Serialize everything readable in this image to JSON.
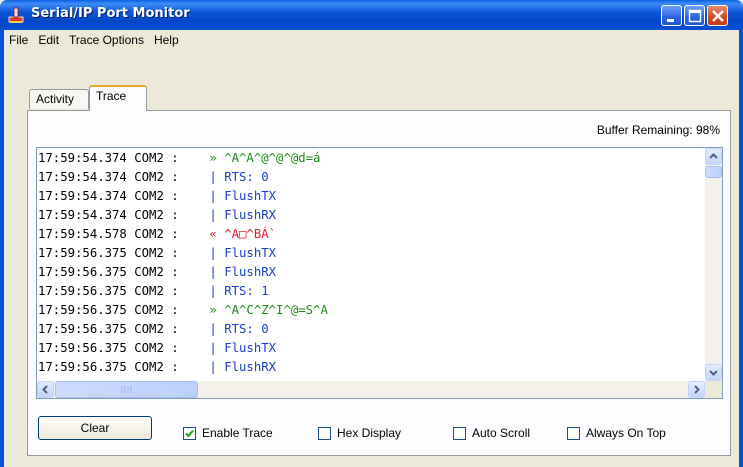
{
  "window": {
    "title": "Serial/IP Port Monitor"
  },
  "menu": [
    "File",
    "Edit",
    "Trace Options",
    "Help"
  ],
  "tabs": [
    {
      "label": "Activity",
      "active": false
    },
    {
      "label": "Trace",
      "active": true
    }
  ],
  "buffer_label": "Buffer Remaining: 98%",
  "trace_rows": [
    {
      "time": "17:59:54.374",
      "port": "COM2",
      "kind": "tx",
      "marker": "»",
      "text": "^A^A^@^@^@d=á"
    },
    {
      "time": "17:59:54.374",
      "port": "COM2",
      "kind": "ctl",
      "marker": "|",
      "text": "RTS: 0"
    },
    {
      "time": "17:59:54.374",
      "port": "COM2",
      "kind": "ctl",
      "marker": "|",
      "text": "FlushTX"
    },
    {
      "time": "17:59:54.374",
      "port": "COM2",
      "kind": "ctl",
      "marker": "|",
      "text": "FlushRX"
    },
    {
      "time": "17:59:54.578",
      "port": "COM2",
      "kind": "rx",
      "marker": "«",
      "text": "^A□^BÁ`"
    },
    {
      "time": "17:59:56.375",
      "port": "COM2",
      "kind": "ctl",
      "marker": "|",
      "text": "FlushTX"
    },
    {
      "time": "17:59:56.375",
      "port": "COM2",
      "kind": "ctl",
      "marker": "|",
      "text": "FlushRX"
    },
    {
      "time": "17:59:56.375",
      "port": "COM2",
      "kind": "ctl",
      "marker": "|",
      "text": "RTS: 1"
    },
    {
      "time": "17:59:56.375",
      "port": "COM2",
      "kind": "tx",
      "marker": "»",
      "text": "^A^C^Z^I^@=S^A"
    },
    {
      "time": "17:59:56.375",
      "port": "COM2",
      "kind": "ctl",
      "marker": "|",
      "text": "RTS: 0"
    },
    {
      "time": "17:59:56.375",
      "port": "COM2",
      "kind": "ctl",
      "marker": "|",
      "text": "FlushTX"
    },
    {
      "time": "17:59:56.375",
      "port": "COM2",
      "kind": "ctl",
      "marker": "|",
      "text": "FlushRX"
    }
  ],
  "buttons": {
    "clear": "Clear"
  },
  "checkboxes": [
    {
      "label": "Enable Trace",
      "checked": true
    },
    {
      "label": "Hex Display",
      "checked": false
    },
    {
      "label": "Auto Scroll",
      "checked": false
    },
    {
      "label": "Always On Top",
      "checked": false
    }
  ],
  "colors": {
    "tx": "#1b8a1b",
    "rx": "#e0202a",
    "control": "#1a3fc8",
    "titlebar": "#0a4fd4"
  },
  "icons": {
    "app": "plug-icon",
    "minimize": "minimize-icon",
    "maximize": "maximize-icon",
    "close": "close-icon"
  }
}
